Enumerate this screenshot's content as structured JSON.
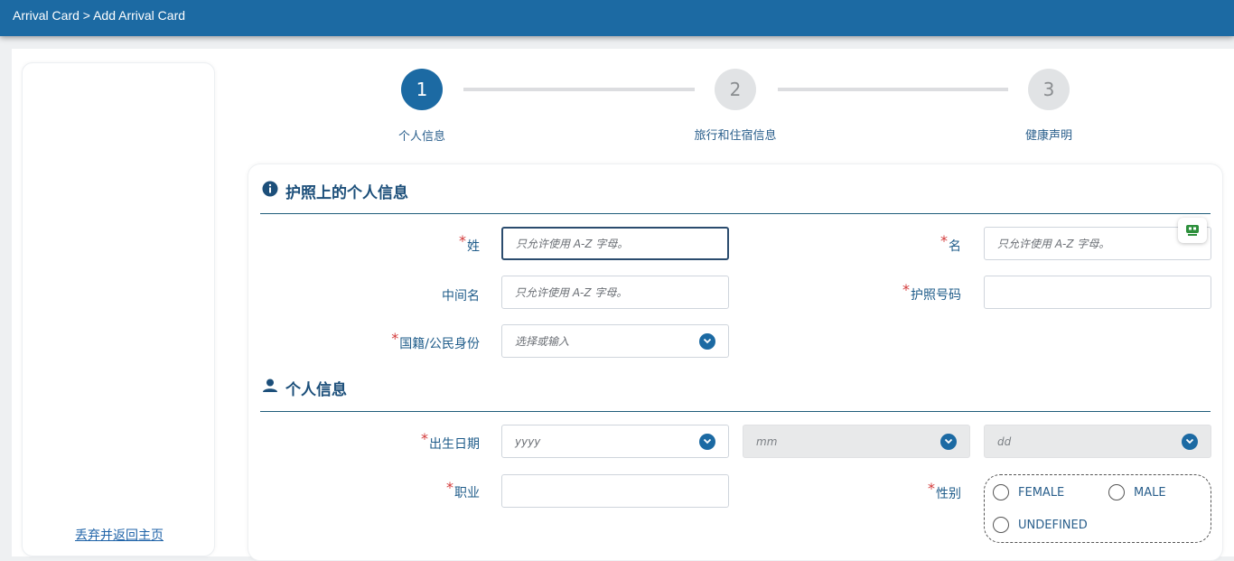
{
  "header": {
    "breadcrumb": "Arrival Card > Add Arrival Card"
  },
  "sidebar": {
    "discard_link": "丢弃并返回主页"
  },
  "steps": [
    {
      "number": "1",
      "label": "个人信息",
      "active": true
    },
    {
      "number": "2",
      "label": "旅行和住宿信息",
      "active": false
    },
    {
      "number": "3",
      "label": "健康声明",
      "active": false
    }
  ],
  "passport_section": {
    "title": "护照上的个人信息",
    "icon": "info-icon",
    "surname_label": "姓",
    "surname_placeholder": "只允许使用 A-Z 字母。",
    "given_name_label": "名",
    "given_name_placeholder": "只允许使用 A-Z 字母。",
    "middle_name_label": "中间名",
    "middle_name_placeholder": "只允许使用 A-Z 字母。",
    "passport_no_label": "护照号码",
    "passport_no_value": "",
    "nationality_label": "国籍/公民身份",
    "nationality_placeholder": "选择或输入"
  },
  "personal_section": {
    "title": "个人信息",
    "icon": "user-icon",
    "dob_label": "出生日期",
    "dob_year_placeholder": "yyyy",
    "dob_month_placeholder": "mm",
    "dob_day_placeholder": "dd",
    "occupation_label": "职业",
    "occupation_value": "",
    "gender_label": "性别",
    "gender_options": [
      "FEMALE",
      "MALE",
      "UNDEFINED"
    ]
  },
  "colors": {
    "primary": "#1c6aa3",
    "required": "#d33a3a",
    "label": "#1f5c8a"
  }
}
